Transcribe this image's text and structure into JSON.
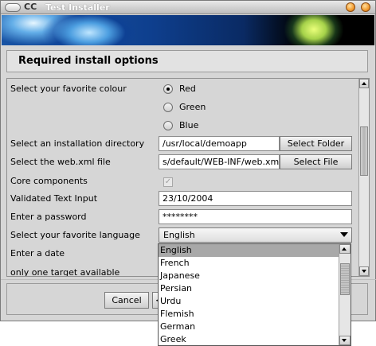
{
  "window": {
    "title": "Test Installer",
    "logo_text": "CC"
  },
  "header": {
    "title": "Required install options"
  },
  "form": {
    "colour": {
      "label": "Select your favorite colour",
      "options": [
        {
          "label": "Red",
          "selected": true
        },
        {
          "label": "Green",
          "selected": false
        },
        {
          "label": "Blue",
          "selected": false
        }
      ]
    },
    "install_dir": {
      "label": "Select an installation directory",
      "value": "/usr/local/demoapp",
      "button": "Select Folder"
    },
    "webxml": {
      "label": "Select the web.xml file",
      "value": "s/default/WEB-INF/web.xml",
      "button": "Select File"
    },
    "core": {
      "label": "Core components",
      "checked": true
    },
    "validated": {
      "label": "Validated Text Input",
      "value": "23/10/2004"
    },
    "password": {
      "label": "Enter a password",
      "value": "********"
    },
    "language": {
      "label": "Select your favorite language",
      "value": "English",
      "options": [
        "English",
        "French",
        "Japanese",
        "Persian",
        "Urdu",
        "Flemish",
        "German",
        "Greek"
      ],
      "selected_index": 0
    },
    "date": {
      "label": "Enter a date"
    },
    "target": {
      "label": "only one target available"
    }
  },
  "footer": {
    "cancel": "Cancel",
    "back": "<"
  }
}
